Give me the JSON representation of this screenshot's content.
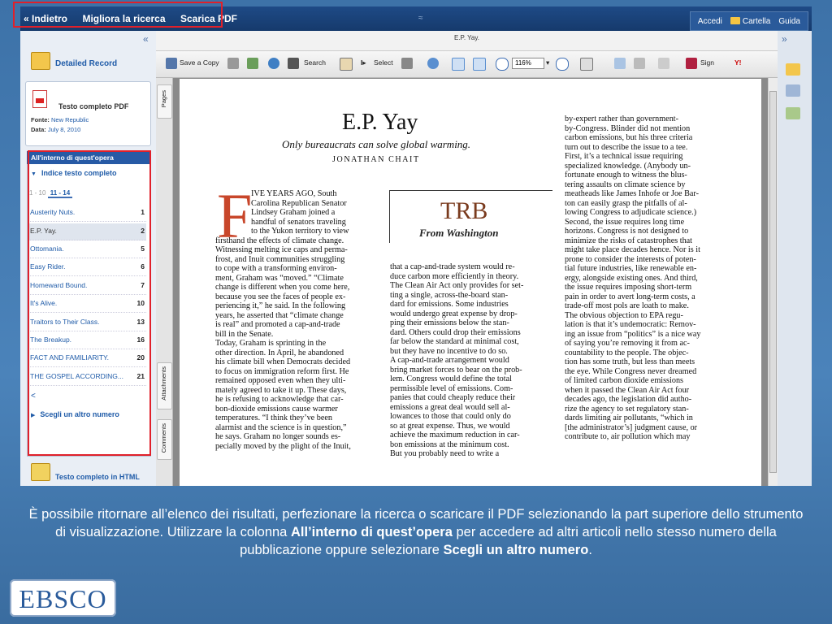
{
  "topbar": {
    "back": "« Indietro",
    "refine": "Migliora la ricerca",
    "download": "Scarica PDF",
    "signin": "Accedi",
    "folder": "Cartella",
    "help": "Guida"
  },
  "left": {
    "detailed_record": "Detailed Record",
    "pdf_title": "Testo completo PDF",
    "source_label": "Fonte:",
    "source_value": "New Republic",
    "date_label": "Data:",
    "date_value": "July 8, 2010",
    "within_issue": "All'interno di quest'opera",
    "index": "Indice testo completo",
    "page_tabs": [
      "1 - 10",
      "11 - 14"
    ],
    "articles": [
      {
        "title": "Austerity Nuts.",
        "page": "1"
      },
      {
        "title": "E.P. Yay.",
        "page": "2"
      },
      {
        "title": "Ottomania.",
        "page": "5"
      },
      {
        "title": "Easy Rider.",
        "page": "6"
      },
      {
        "title": "Homeward Bound.",
        "page": "7"
      },
      {
        "title": "It's Alive.",
        "page": "10"
      },
      {
        "title": "Traitors to Their Class.",
        "page": "13"
      },
      {
        "title": "The Breakup.",
        "page": "16"
      },
      {
        "title": "FACT AND FAMILIARITY.",
        "page": "20"
      },
      {
        "title": "THE GOSPEL ACCORDING...",
        "page": "21"
      }
    ],
    "prev": "<",
    "choose_other": "Scegli un altro numero",
    "html_full_text": "Testo completo in HTML"
  },
  "viewer": {
    "title": "E.P. Yay.",
    "save_copy": "Save a Copy",
    "search": "Search",
    "select": "Select",
    "zoom": "116%",
    "sign": "Sign",
    "tab_pages": "Pages",
    "tab_attachments": "Attachments",
    "tab_comments": "Comments"
  },
  "article": {
    "headline": "E.P. Yay",
    "subhead": "Only bureaucrats can solve global warming.",
    "author": "JONATHAN CHAIT",
    "dropcap": "F",
    "trb": "TRB",
    "trb_sub": "From Washington",
    "col1": [
      "IVE YEARS AGO, South",
      "Carolina Republican Senator",
      "Lindsey Graham joined a",
      "handful of senators traveling",
      "to the Yukon territory to view",
      "firsthand the effects of climate change.",
      "Witnessing melting ice caps and perma-",
      "frost, and Inuit communities struggling",
      "to cope with a transforming environ-",
      "ment, Graham was “moved.” “Climate",
      "change is different when you come here,",
      "because you see the faces of people ex-",
      "periencing it,” he said. In the following",
      "years, he asserted that “climate change",
      "is real” and promoted a cap-and-trade",
      "bill in the Senate.",
      "   Today, Graham is sprinting in the",
      "other direction. In April, he abandoned",
      "his climate bill when Democrats decided",
      "to focus on immigration reform first. He",
      "remained opposed even when they ulti-",
      "mately agreed to take it up. These days,",
      "he is refusing to acknowledge that car-",
      "bon-dioxide emissions cause warmer",
      "temperatures. “I think they’ve been",
      "alarmist and the science is in question,”",
      "he says. Graham no longer sounds es-",
      "pecially moved by the plight of the Inuit,"
    ],
    "col2": [
      "that a cap-and-trade system would re-",
      "duce carbon more efficiently in theory.",
      "The Clean Air Act only provides for set-",
      "ting a single, across-the-board stan-",
      "dard for emissions. Some industries",
      "would undergo great expense by drop-",
      "ping their emissions below the stan-",
      "dard. Others could drop their emissions",
      "far below the standard at minimal cost,",
      "but they have no incentive to do so.",
      "   A cap-and-trade arrangement would",
      "bring market forces to bear on the prob-",
      "lem. Congress would define the total",
      "permissible level of emissions. Com-",
      "panies that could cheaply reduce their",
      "emissions a great deal would sell al-",
      "lowances to those that could only do",
      "so at great expense. Thus, we would",
      "achieve the maximum reduction in car-",
      "bon emissions at the minimum cost.",
      "   But you probably need to write a"
    ],
    "col3": [
      "by-expert rather than government-",
      "by-Congress. Blinder did not mention",
      "carbon emissions, but his three criteria",
      "turn out to describe the issue to a tee.",
      "   First, it’s a technical issue requiring",
      "specialized knowledge. (Anybody un-",
      "fortunate enough to witness the blus-",
      "tering assaults on climate science by",
      "meatheads like James Inhofe or Joe Bar-",
      "ton can easily grasp the pitfalls of al-",
      "lowing Congress to adjudicate science.)",
      "Second, the issue requires long time",
      "horizons. Congress is not designed to",
      "minimize the risks of catastrophes that",
      "might take place decades hence. Nor is it",
      "prone to consider the interests of poten-",
      "tial future industries, like renewable en-",
      "ergy, alongside existing ones. And third,",
      "the issue requires imposing short-term",
      "pain in order to avert long-term costs, a",
      "trade-off most pols are loath to make.",
      "   The obvious objection to EPA regu-",
      "lation is that it’s undemocratic: Remov-",
      "ing an issue from “politics” is a nice way",
      "of saying you’re removing it from ac-",
      "countability to the people. The objec-",
      "tion has some truth, but less than meets",
      "the eye. While Congress never dreamed",
      "of limited carbon dioxide emissions",
      "when it passed the Clean Air Act four",
      "decades ago, the legislation did autho-",
      "rize the agency to set regulatory stan-",
      "dards limiting air pollutants, “which in",
      "[the administrator’s] judgment cause, or",
      "contribute to, air pollution which may"
    ]
  },
  "caption": {
    "part1": "È possibile ritornare all’elenco dei risultati, perfezionare la ricerca o scaricare il PDF selezionando la part superiore dello strumento di visualizzazione. Utilizzare la colonna ",
    "bold1": "All’interno di quest’opera",
    "part2": " per accedere ad altri articoli nello stesso numero della pubblicazione oppure selezionare ",
    "bold2": "Scegli un altro numero",
    "part3": "."
  },
  "logo": "EBSCO",
  "colors": {
    "accent_red": "#e0202a",
    "topbar": "#1e4a86",
    "link": "#1f5ba8"
  }
}
